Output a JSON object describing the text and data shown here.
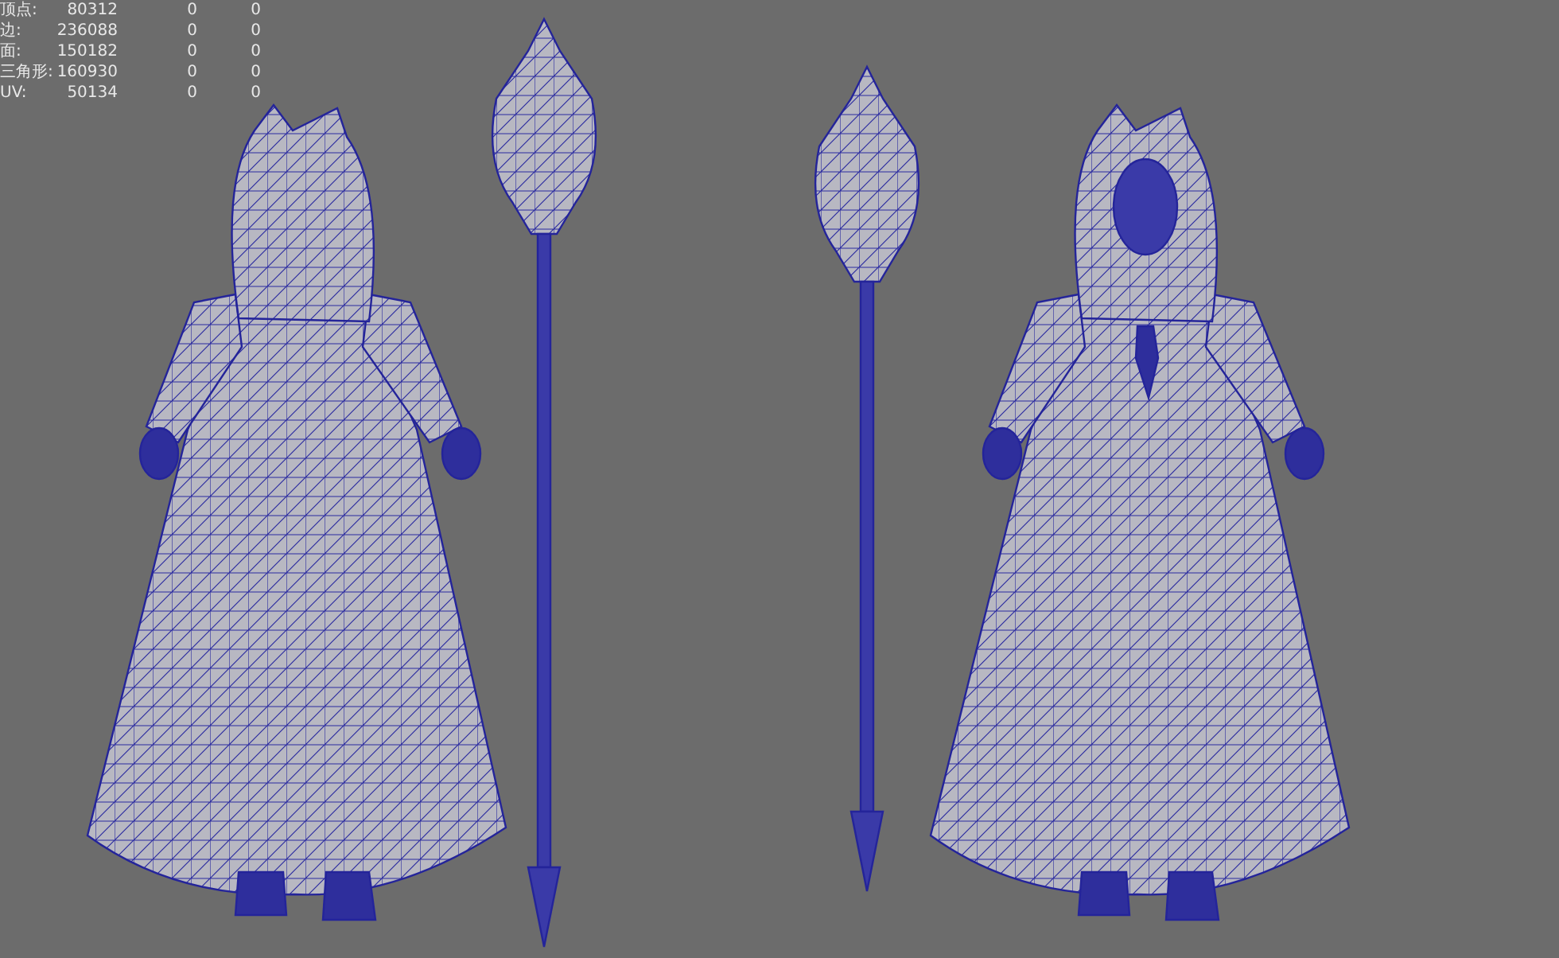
{
  "hud": {
    "rows": [
      {
        "label": "顶点:",
        "values": [
          "80312",
          "0",
          "0"
        ]
      },
      {
        "label": "边:",
        "values": [
          "236088",
          "0",
          "0"
        ]
      },
      {
        "label": "面:",
        "values": [
          "150182",
          "0",
          "0"
        ]
      },
      {
        "label": "三角形:",
        "values": [
          "160930",
          "0",
          "0"
        ]
      },
      {
        "label": "UV:",
        "values": [
          "50134",
          "0",
          "0"
        ]
      }
    ]
  }
}
